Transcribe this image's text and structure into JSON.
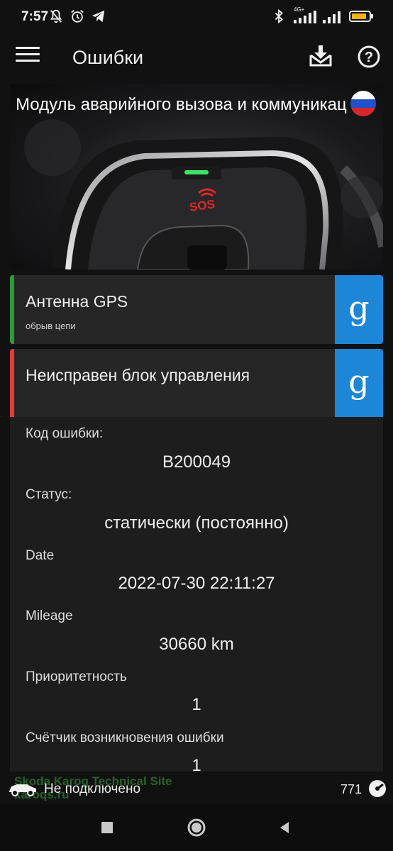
{
  "status_bar": {
    "time": "7:57",
    "network": "4G+",
    "icons_left": [
      "bell-off-icon",
      "alarm-icon",
      "telegram-icon"
    ],
    "icons_right": [
      "bluetooth-icon",
      "signal-icon",
      "signal-icon",
      "battery-icon"
    ]
  },
  "app_bar": {
    "title": "Ошибки",
    "actions": [
      "download-icon",
      "help-icon"
    ]
  },
  "module": {
    "title": "Модуль аварийного вызова и коммуникац",
    "flag": "russia",
    "image_text": "SOS"
  },
  "errors": [
    {
      "title": "Антенна GPS",
      "subtitle": "обрыв цепи",
      "stripe_color": "#2e9b3a",
      "search_label": "g"
    },
    {
      "title": "Неисправен блок управления",
      "subtitle": "",
      "stripe_color": "#e53935",
      "search_label": "g"
    }
  ],
  "details": [
    {
      "label": "Код ошибки:",
      "value": "B200049"
    },
    {
      "label": "Статус:",
      "value": "статически (постоянно)"
    },
    {
      "label": "Date",
      "value": "2022-07-30 22:11:27"
    },
    {
      "label": "Mileage",
      "value": "30660 km"
    },
    {
      "label": "Приоритетность",
      "value": "1"
    },
    {
      "label": "Счётчик возникновения ошибки",
      "value": "1"
    }
  ],
  "bottom": {
    "connection": "Не подключено",
    "watermark_line1": "Skoda Karoq Technical Site",
    "watermark_line2": "karoqs.ru",
    "count": "771"
  },
  "colors": {
    "accent_blue": "#1d86d6",
    "ok_green": "#2e9b3a",
    "error_red": "#e53935"
  }
}
